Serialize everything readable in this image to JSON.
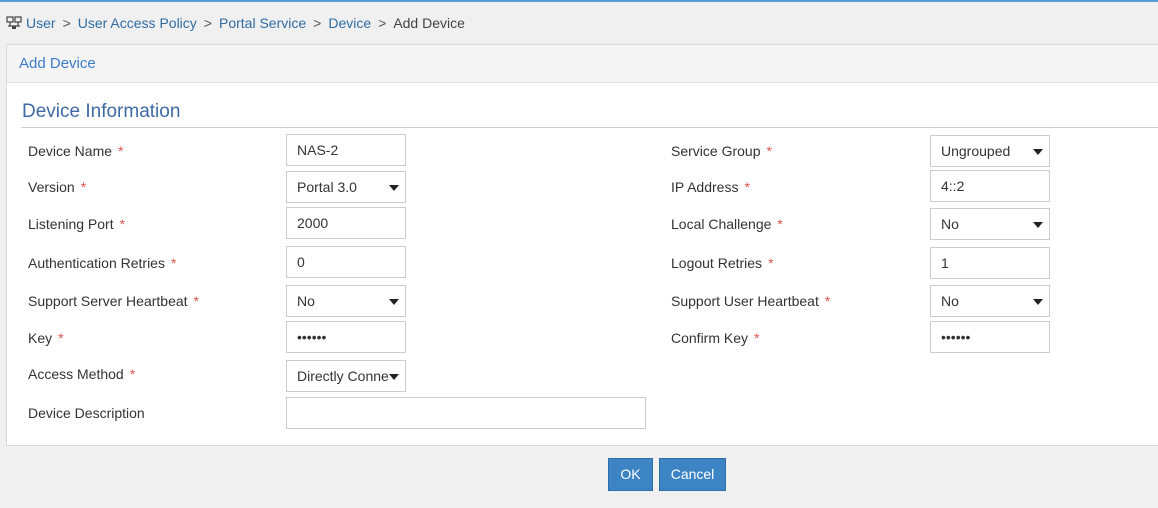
{
  "breadcrumb": {
    "items": [
      "User",
      "User Access Policy",
      "Portal Service",
      "Device"
    ],
    "current": "Add Device",
    "separator": ">"
  },
  "panel": {
    "title": "Add Device",
    "section_title": "Device Information"
  },
  "form": {
    "device_name": {
      "label": "Device Name",
      "value": "NAS-2"
    },
    "version": {
      "label": "Version",
      "value": "Portal 3.0"
    },
    "listening_port": {
      "label": "Listening Port",
      "value": "2000"
    },
    "auth_retries": {
      "label": "Authentication Retries",
      "value": "0"
    },
    "server_heartbeat": {
      "label": "Support Server Heartbeat",
      "value": "No"
    },
    "key": {
      "label": "Key",
      "value": "••••••"
    },
    "access_method": {
      "label": "Access Method",
      "value": "Directly Conne"
    },
    "device_description": {
      "label": "Device Description",
      "value": ""
    },
    "service_group": {
      "label": "Service Group",
      "value": "Ungrouped"
    },
    "ip_address": {
      "label": "IP Address",
      "value": "4::2"
    },
    "local_challenge": {
      "label": "Local Challenge",
      "value": "No"
    },
    "logout_retries": {
      "label": "Logout Retries",
      "value": "1"
    },
    "user_heartbeat": {
      "label": "Support User Heartbeat",
      "value": "No"
    },
    "confirm_key": {
      "label": "Confirm Key",
      "value": "••••••"
    },
    "required_mark": "*"
  },
  "buttons": {
    "ok": "OK",
    "cancel": "Cancel"
  },
  "colors": {
    "accent": "#3d84c4",
    "link": "#2e6da4",
    "required": "#d9534f"
  }
}
